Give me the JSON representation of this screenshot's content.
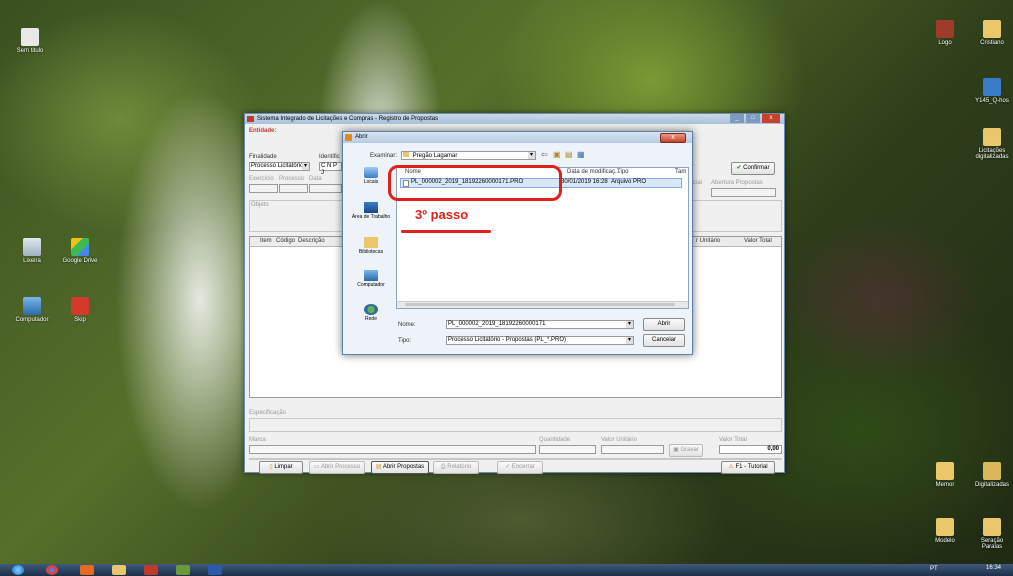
{
  "desktop": {
    "icons_left": [
      {
        "label": "Sem titulo"
      },
      {
        "label": "Lixeira"
      },
      {
        "label": "Google Drive"
      },
      {
        "label": "Computador"
      },
      {
        "label": "Skip"
      }
    ],
    "icons_right": [
      {
        "label": "Logo"
      },
      {
        "label": "Cristiano"
      },
      {
        "label": "Y145_Q-hos"
      },
      {
        "label": "Licitações digitalizadas"
      },
      {
        "label": "Memor"
      },
      {
        "label": "Digitalizadas"
      },
      {
        "label": "Modelo"
      },
      {
        "label": "Seração Paralas"
      }
    ]
  },
  "main_window": {
    "title": "Sistema Integrado de Licitações e Compras - Registro de Propostas",
    "entidade_label": "Entidade:",
    "finalidade_label": "Finalidade",
    "finalidade_value": "Processo Licitatório",
    "identificacao_label": "Identific",
    "cnpj_prefix": "C N P J",
    "exercicio_label": "Exercício",
    "processo_label": "Processo",
    "data_label": "Data",
    "objeto_label": "Objeto",
    "confirmar_label": "Confirmar",
    "cial_label": "cial",
    "abertura_label": "Abertura Propostas",
    "table_headers": [
      "Item",
      "Código",
      "Descrição"
    ],
    "table_headers_right": [
      "r Unitário",
      "Valor Total"
    ],
    "especificacao_label": "Especificação",
    "marca_label": "Marca",
    "quantidade_label": "Quantidade",
    "valor_unitario_label": "Valor Unitário",
    "valor_total_label": "Valor Total",
    "valor_total_value": "0,00",
    "gravar_label": "Gravar",
    "buttons": {
      "limpar": "Limpar",
      "abrir_processo": "Abrir Processo",
      "abrir_propostas": "Abrir Propostas",
      "relatorio": "Relatório",
      "encerrar": "Encerrar",
      "tutorial": "F1 - Tutorial"
    }
  },
  "dialog": {
    "title": "Abrir",
    "examinar_label": "Examinar:",
    "folder": "Pregão Lagamar",
    "columns": {
      "nome": "Nome",
      "data": "Data de modificaç...",
      "tipo": "Tipo",
      "tam": "Tam"
    },
    "file": {
      "name": "PL_000002_2019_18192260000171.PRO",
      "date": "30/01/2019 16:28",
      "type": "Arquivo PRO"
    },
    "places": [
      "Locais",
      "Área de Trabalho",
      "Bibliotecas",
      "Computador",
      "Rede"
    ],
    "nome_label": "Nome:",
    "nome_value": "PL_000002_2019_18192260000171",
    "tipo_label": "Tipo:",
    "tipo_value": "Processo Licitatório - Propostas (PL_*.PRO)",
    "abrir_button": "Abrir",
    "cancelar_button": "Cancelar"
  },
  "annotation": {
    "text": "3º passo",
    "color": "#e0201b"
  },
  "taskbar": {
    "lang": "PT",
    "time": "16:34"
  }
}
